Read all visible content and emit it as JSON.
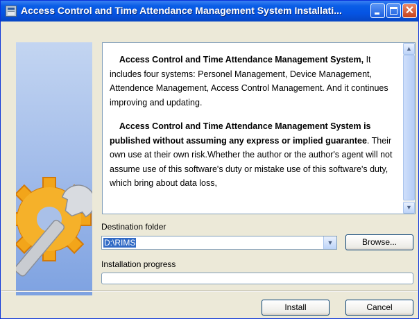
{
  "window": {
    "title": "Access Control and Time Attendance Management System Installati...",
    "controls": {
      "minimize": "minimize-icon",
      "maximize": "maximize-icon",
      "close": "close-icon"
    },
    "close_glyph": "✕"
  },
  "license": {
    "p1_bold": "Access Control and Time Attendance Management System,",
    "p1_rest": " It includes four systems: Personel Management, Device Management, Attendence Management, Access Control Management. And it continues improving and updating.",
    "p2_bold": "Access Control and Time Attendance Management System is published without assuming any express or implied guarantee",
    "p2_rest": ". Their own use at their own risk.Whether the author or the author's agent will not assume use of this software's duty or mistake use of this software's duty, which bring about data loss,"
  },
  "destination": {
    "label": "Destination folder",
    "value": "D:\\RIMS",
    "browse_label": "Browse..."
  },
  "progress": {
    "label": "Installation progress",
    "fraction": 0
  },
  "footer": {
    "install_label": "Install",
    "cancel_label": "Cancel"
  },
  "colors": {
    "titlebar": "#0554e3",
    "selection": "#316ac5",
    "dialog_bg": "#ece9d8"
  }
}
